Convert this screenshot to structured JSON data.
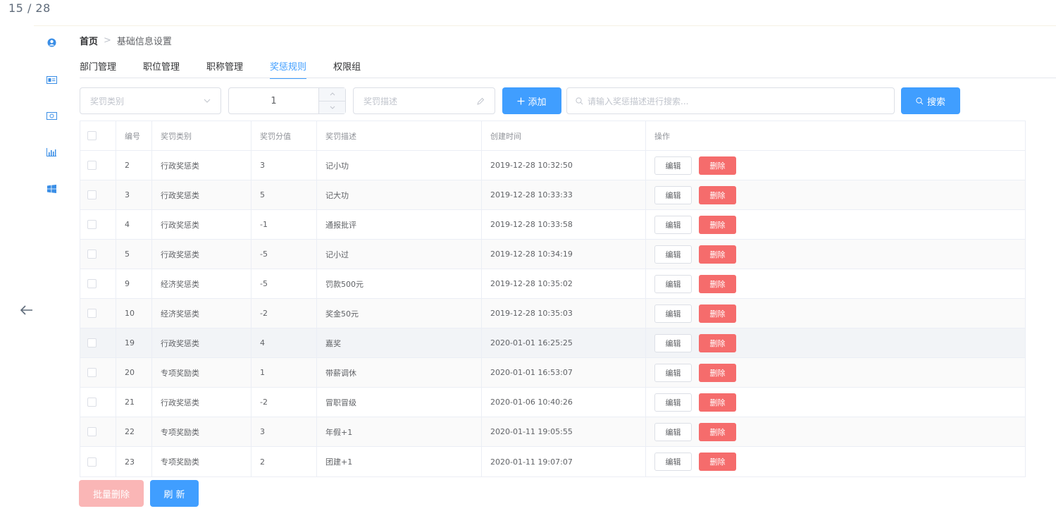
{
  "page_counter": "15 / 28",
  "sidebar": {
    "icons": [
      "user-circle-icon",
      "id-card-icon",
      "money-icon",
      "bar-chart-icon",
      "windows-icon"
    ]
  },
  "breadcrumb": {
    "home": "首页",
    "separator": ">",
    "current": "基础信息设置"
  },
  "tabs": [
    {
      "label": "部门管理",
      "active": false
    },
    {
      "label": "职位管理",
      "active": false
    },
    {
      "label": "职称管理",
      "active": false
    },
    {
      "label": "奖惩规则",
      "active": true
    },
    {
      "label": "权限组",
      "active": false
    }
  ],
  "toolbar": {
    "type_placeholder": "奖罚类别",
    "score_value": "1",
    "desc_placeholder": "奖罚描述",
    "add_label": "添加",
    "search_placeholder": "请输入奖惩描述进行搜索...",
    "search_label": "搜索"
  },
  "table": {
    "headers": [
      "编号",
      "奖罚类别",
      "奖罚分值",
      "奖罚描述",
      "创建时间",
      "操作"
    ],
    "edit_label": "编辑",
    "delete_label": "删除",
    "rows": [
      {
        "id": "2",
        "type": "行政奖惩类",
        "score": "3",
        "desc": "记小功",
        "time": "2019-12-28 10:32:50"
      },
      {
        "id": "3",
        "type": "行政奖惩类",
        "score": "5",
        "desc": "记大功",
        "time": "2019-12-28 10:33:33"
      },
      {
        "id": "4",
        "type": "行政奖惩类",
        "score": "-1",
        "desc": "通报批评",
        "time": "2019-12-28 10:33:58"
      },
      {
        "id": "5",
        "type": "行政奖惩类",
        "score": "-5",
        "desc": "记小过",
        "time": "2019-12-28 10:34:19"
      },
      {
        "id": "9",
        "type": "经济奖惩类",
        "score": "-5",
        "desc": "罚款500元",
        "time": "2019-12-28 10:35:02"
      },
      {
        "id": "10",
        "type": "经济奖惩类",
        "score": "-2",
        "desc": "奖金50元",
        "time": "2019-12-28 10:35:03"
      },
      {
        "id": "19",
        "type": "行政奖惩类",
        "score": "4",
        "desc": "嘉奖",
        "time": "2020-01-01 16:25:25"
      },
      {
        "id": "20",
        "type": "专项奖励类",
        "score": "1",
        "desc": "带薪调休",
        "time": "2020-01-01 16:53:07"
      },
      {
        "id": "21",
        "type": "行政奖惩类",
        "score": "-2",
        "desc": "冒职冒级",
        "time": "2020-01-06 10:40:26"
      },
      {
        "id": "22",
        "type": "专项奖励类",
        "score": "3",
        "desc": "年假+1",
        "time": "2020-01-11 19:05:55"
      },
      {
        "id": "23",
        "type": "专项奖励类",
        "score": "2",
        "desc": "团建+1",
        "time": "2020-01-11 19:07:07"
      }
    ]
  },
  "footer": {
    "batch_delete_label": "批量删除",
    "refresh_label": "刷 新"
  },
  "colors": {
    "primary": "#409eff",
    "danger": "#f56c6c",
    "danger_light": "#fab6b6"
  }
}
